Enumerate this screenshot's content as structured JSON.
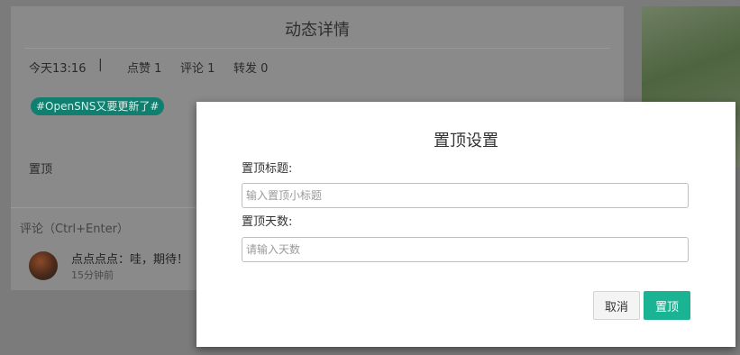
{
  "page": {
    "title": "动态详情",
    "meta": {
      "time": "今天13:16",
      "separator": "|",
      "likes": "点赞 1",
      "comments": "评论 1",
      "reposts": "转发 0"
    },
    "tag": "#OpenSNS又要更新了#",
    "pin_label": "置顶",
    "comment_header": "评论（Ctrl+Enter）",
    "comment": {
      "text": "点点点点：哇，期待！",
      "time": "15分钟前"
    }
  },
  "modal": {
    "title": "置顶设置",
    "title_label": "置顶标题:",
    "title_placeholder": "输入置顶小标题",
    "days_label": "置顶天数:",
    "days_placeholder": "请输入天数",
    "cancel_label": "取消",
    "confirm_label": "置顶"
  },
  "colors": {
    "overlay": "#7b7b7b",
    "accent": "#1ab394",
    "tag_bg": "#117f70"
  }
}
